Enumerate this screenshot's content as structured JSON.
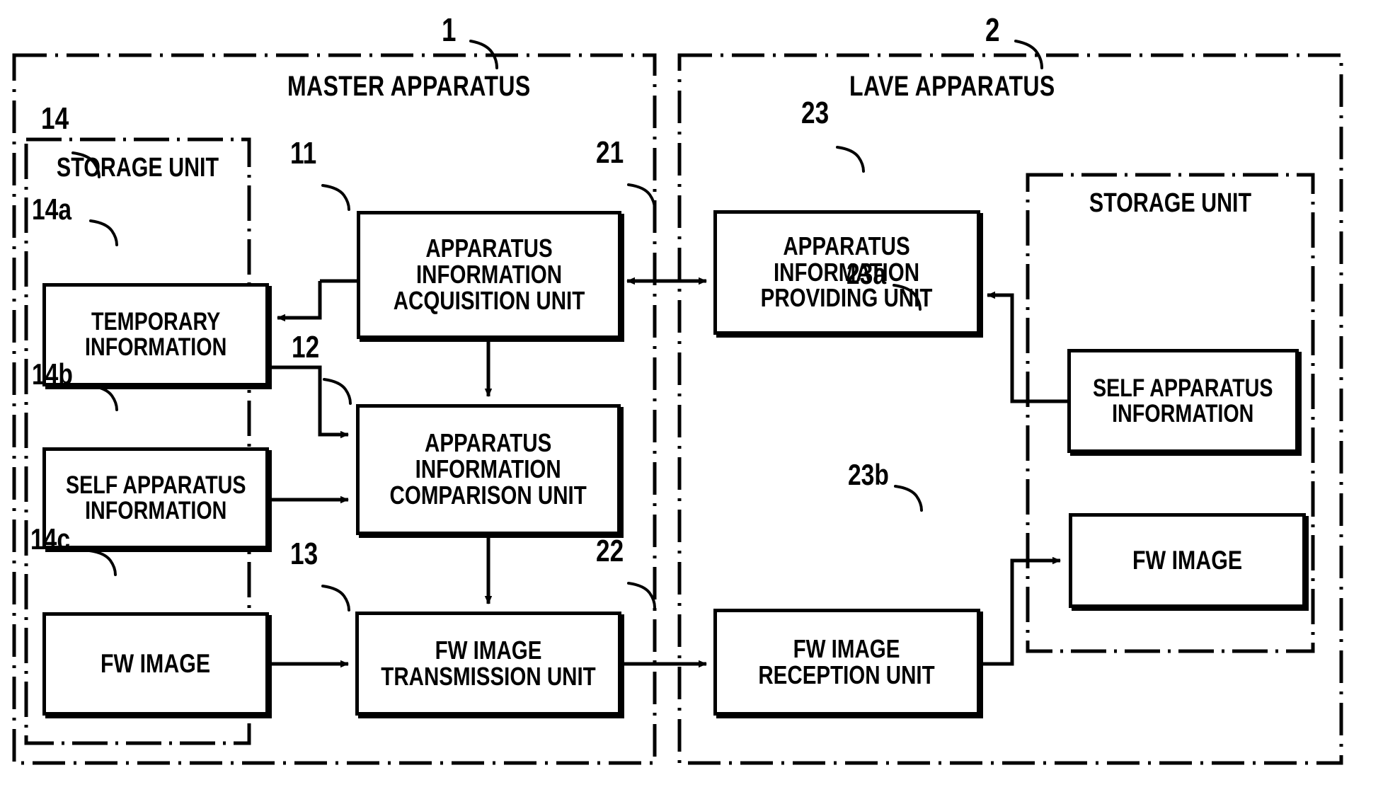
{
  "figure": {
    "type": "patent-block-diagram",
    "background": "#ffffff",
    "line_color": "#000000"
  },
  "apparatus": {
    "master": {
      "ref": "1",
      "title": "MASTER APPARATUS",
      "storage": {
        "ref": "14",
        "title": "STORAGE UNIT",
        "items": [
          {
            "ref": "14a",
            "label_line1": "TEMPORARY",
            "label_line2": "INFORMATION"
          },
          {
            "ref": "14b",
            "label_line1": "SELF APPARATUS",
            "label_line2": "INFORMATION"
          },
          {
            "ref": "14c",
            "label_line1": "FW IMAGE",
            "label_line2": ""
          }
        ]
      },
      "units": [
        {
          "ref": "11",
          "label_line1": "APPARATUS",
          "label_line2": "INFORMATION",
          "label_line3": "ACQUISITION UNIT"
        },
        {
          "ref": "12",
          "label_line1": "APPARATUS",
          "label_line2": "INFORMATION",
          "label_line3": "COMPARISON UNIT"
        },
        {
          "ref": "13",
          "label_line1": "FW IMAGE",
          "label_line2": "TRANSMISSION UNIT",
          "label_line3": ""
        }
      ]
    },
    "slave": {
      "ref": "2",
      "title": "LAVE APPARATUS",
      "storage": {
        "ref": "23",
        "title": "STORAGE UNIT",
        "items": [
          {
            "ref": "23a",
            "label_line1": "SELF APPARATUS",
            "label_line2": "INFORMATION"
          },
          {
            "ref": "23b",
            "label_line1": "FW IMAGE",
            "label_line2": ""
          }
        ]
      },
      "units": [
        {
          "ref": "21",
          "label_line1": "APPARATUS",
          "label_line2": "INFORMATION",
          "label_line3": "PROVIDING UNIT"
        },
        {
          "ref": "22",
          "label_line1": "FW IMAGE",
          "label_line2": "RECEPTION UNIT",
          "label_line3": ""
        }
      ]
    }
  },
  "connections": [
    {
      "from": "11",
      "to": "14a",
      "kind": "arrow-left"
    },
    {
      "from": "11",
      "to": "12",
      "kind": "arrow-down"
    },
    {
      "from": "14a",
      "to": "12",
      "kind": "arrow-right"
    },
    {
      "from": "14b",
      "to": "12",
      "kind": "arrow-right"
    },
    {
      "from": "12",
      "to": "13",
      "kind": "arrow-down"
    },
    {
      "from": "14c",
      "to": "13",
      "kind": "arrow-right"
    },
    {
      "from": "11",
      "to": "21",
      "kind": "arrow-bidirectional"
    },
    {
      "from": "13",
      "to": "22",
      "kind": "arrow-right"
    },
    {
      "from": "23a",
      "to": "21",
      "kind": "arrow-left"
    },
    {
      "from": "22",
      "to": "23b",
      "kind": "arrow-right"
    }
  ]
}
